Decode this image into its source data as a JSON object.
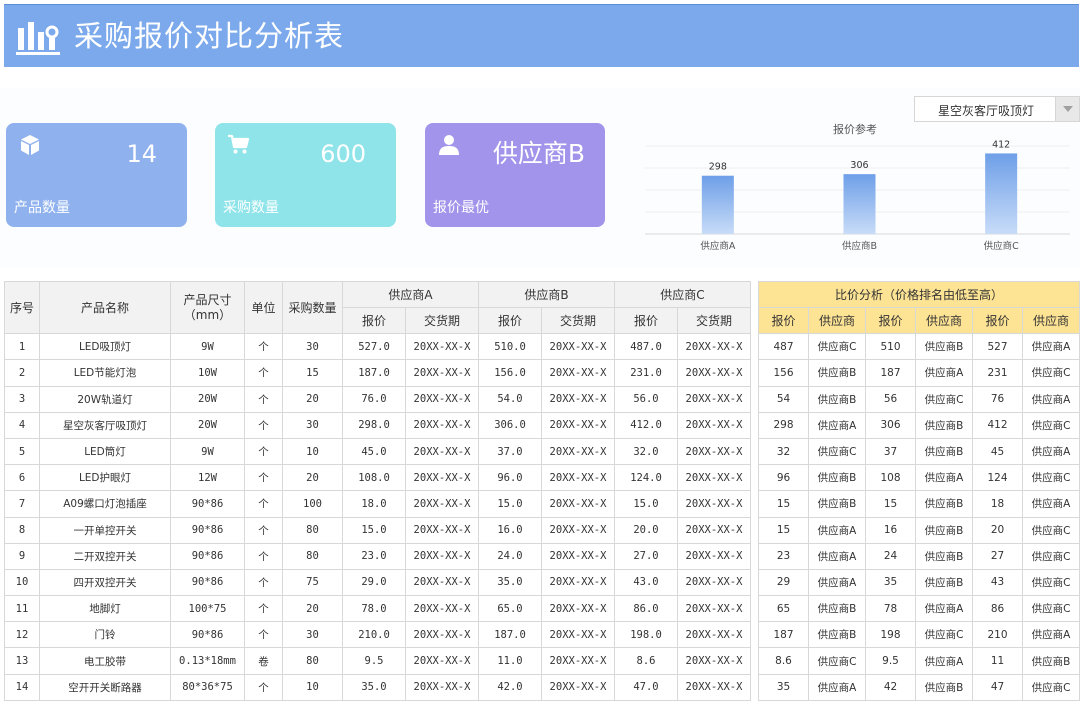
{
  "title": "采购报价对比分析表",
  "cards": [
    {
      "value": "14",
      "label": "产品数量",
      "icon": "cube-icon"
    },
    {
      "value": "600",
      "label": "采购数量",
      "icon": "cart-icon"
    },
    {
      "value": "供应商B",
      "label": "报价最优",
      "icon": "person-icon"
    }
  ],
  "dropdown": {
    "selected": "星空灰客厅吸顶灯"
  },
  "chart_data": {
    "type": "bar",
    "title": "报价参考",
    "categories": [
      "供应商A",
      "供应商B",
      "供应商C"
    ],
    "values": [
      298,
      306,
      412
    ],
    "color": "#7ba9ec",
    "ylim": [
      0,
      450
    ],
    "grid": true
  },
  "table": {
    "headers": {
      "index": "序号",
      "name": "产品名称",
      "size": "产品尺寸（mm）",
      "unit": "单位",
      "qty": "采购数量",
      "supA": "供应商A",
      "supB": "供应商B",
      "supC": "供应商C",
      "price": "报价",
      "delivery": "交货期"
    },
    "rows": [
      {
        "no": "1",
        "name": "LED吸顶灯",
        "size": "9W",
        "unit": "个",
        "qty": "30",
        "pa": "527.0",
        "da": "20XX-XX-X",
        "pb": "510.0",
        "db": "20XX-XX-X",
        "pc": "487.0",
        "dc": "20XX-XX-X"
      },
      {
        "no": "2",
        "name": "LED节能灯泡",
        "size": "10W",
        "unit": "个",
        "qty": "15",
        "pa": "187.0",
        "da": "20XX-XX-X",
        "pb": "156.0",
        "db": "20XX-XX-X",
        "pc": "231.0",
        "dc": "20XX-XX-X"
      },
      {
        "no": "3",
        "name": "20W轨道灯",
        "size": "20W",
        "unit": "个",
        "qty": "20",
        "pa": "76.0",
        "da": "20XX-XX-X",
        "pb": "54.0",
        "db": "20XX-XX-X",
        "pc": "56.0",
        "dc": "20XX-XX-X"
      },
      {
        "no": "4",
        "name": "星空灰客厅吸顶灯",
        "size": "20W",
        "unit": "个",
        "qty": "30",
        "pa": "298.0",
        "da": "20XX-XX-X",
        "pb": "306.0",
        "db": "20XX-XX-X",
        "pc": "412.0",
        "dc": "20XX-XX-X"
      },
      {
        "no": "5",
        "name": "LED筒灯",
        "size": "9W",
        "unit": "个",
        "qty": "10",
        "pa": "45.0",
        "da": "20XX-XX-X",
        "pb": "37.0",
        "db": "20XX-XX-X",
        "pc": "32.0",
        "dc": "20XX-XX-X"
      },
      {
        "no": "6",
        "name": "LED护眼灯",
        "size": "12W",
        "unit": "个",
        "qty": "20",
        "pa": "108.0",
        "da": "20XX-XX-X",
        "pb": "96.0",
        "db": "20XX-XX-X",
        "pc": "124.0",
        "dc": "20XX-XX-X"
      },
      {
        "no": "7",
        "name": "A09螺口灯泡插座",
        "size": "90*86",
        "unit": "个",
        "qty": "100",
        "pa": "18.0",
        "da": "20XX-XX-X",
        "pb": "15.0",
        "db": "20XX-XX-X",
        "pc": "15.0",
        "dc": "20XX-XX-X"
      },
      {
        "no": "8",
        "name": "一开单控开关",
        "size": "90*86",
        "unit": "个",
        "qty": "80",
        "pa": "15.0",
        "da": "20XX-XX-X",
        "pb": "16.0",
        "db": "20XX-XX-X",
        "pc": "20.0",
        "dc": "20XX-XX-X"
      },
      {
        "no": "9",
        "name": "二开双控开关",
        "size": "90*86",
        "unit": "个",
        "qty": "80",
        "pa": "23.0",
        "da": "20XX-XX-X",
        "pb": "24.0",
        "db": "20XX-XX-X",
        "pc": "27.0",
        "dc": "20XX-XX-X"
      },
      {
        "no": "10",
        "name": "四开双控开关",
        "size": "90*86",
        "unit": "个",
        "qty": "75",
        "pa": "29.0",
        "da": "20XX-XX-X",
        "pb": "35.0",
        "db": "20XX-XX-X",
        "pc": "43.0",
        "dc": "20XX-XX-X"
      },
      {
        "no": "11",
        "name": "地脚灯",
        "size": "100*75",
        "unit": "个",
        "qty": "20",
        "pa": "78.0",
        "da": "20XX-XX-X",
        "pb": "65.0",
        "db": "20XX-XX-X",
        "pc": "86.0",
        "dc": "20XX-XX-X"
      },
      {
        "no": "12",
        "name": "门铃",
        "size": "90*86",
        "unit": "个",
        "qty": "30",
        "pa": "210.0",
        "da": "20XX-XX-X",
        "pb": "187.0",
        "db": "20XX-XX-X",
        "pc": "198.0",
        "dc": "20XX-XX-X"
      },
      {
        "no": "13",
        "name": "电工胶带",
        "size": "0.13*18mm",
        "unit": "卷",
        "qty": "80",
        "pa": "9.5",
        "da": "20XX-XX-X",
        "pb": "11.0",
        "db": "20XX-XX-X",
        "pc": "8.6",
        "dc": "20XX-XX-X"
      },
      {
        "no": "14",
        "name": "空开开关断路器",
        "size": "80*36*75",
        "unit": "个",
        "qty": "10",
        "pa": "35.0",
        "da": "20XX-XX-X",
        "pb": "42.0",
        "db": "20XX-XX-X",
        "pc": "47.0",
        "dc": "20XX-XX-X"
      }
    ]
  },
  "comparison": {
    "title": "比价分析（价格排名由低至高）",
    "price_label": "报价",
    "supplier_label": "供应商",
    "rows": [
      [
        "487",
        "供应商C",
        "510",
        "供应商B",
        "527",
        "供应商A"
      ],
      [
        "156",
        "供应商B",
        "187",
        "供应商A",
        "231",
        "供应商C"
      ],
      [
        "54",
        "供应商B",
        "56",
        "供应商C",
        "76",
        "供应商A"
      ],
      [
        "298",
        "供应商A",
        "306",
        "供应商B",
        "412",
        "供应商C"
      ],
      [
        "32",
        "供应商C",
        "37",
        "供应商B",
        "45",
        "供应商A"
      ],
      [
        "96",
        "供应商B",
        "108",
        "供应商A",
        "124",
        "供应商C"
      ],
      [
        "15",
        "供应商B",
        "15",
        "供应商B",
        "18",
        "供应商A"
      ],
      [
        "15",
        "供应商A",
        "16",
        "供应商B",
        "20",
        "供应商C"
      ],
      [
        "23",
        "供应商A",
        "24",
        "供应商B",
        "27",
        "供应商C"
      ],
      [
        "29",
        "供应商A",
        "35",
        "供应商B",
        "43",
        "供应商C"
      ],
      [
        "65",
        "供应商B",
        "78",
        "供应商A",
        "86",
        "供应商C"
      ],
      [
        "187",
        "供应商B",
        "198",
        "供应商C",
        "210",
        "供应商A"
      ],
      [
        "8.6",
        "供应商C",
        "9.5",
        "供应商A",
        "11",
        "供应商B"
      ],
      [
        "35",
        "供应商A",
        "42",
        "供应商B",
        "47",
        "供应商C"
      ]
    ]
  }
}
